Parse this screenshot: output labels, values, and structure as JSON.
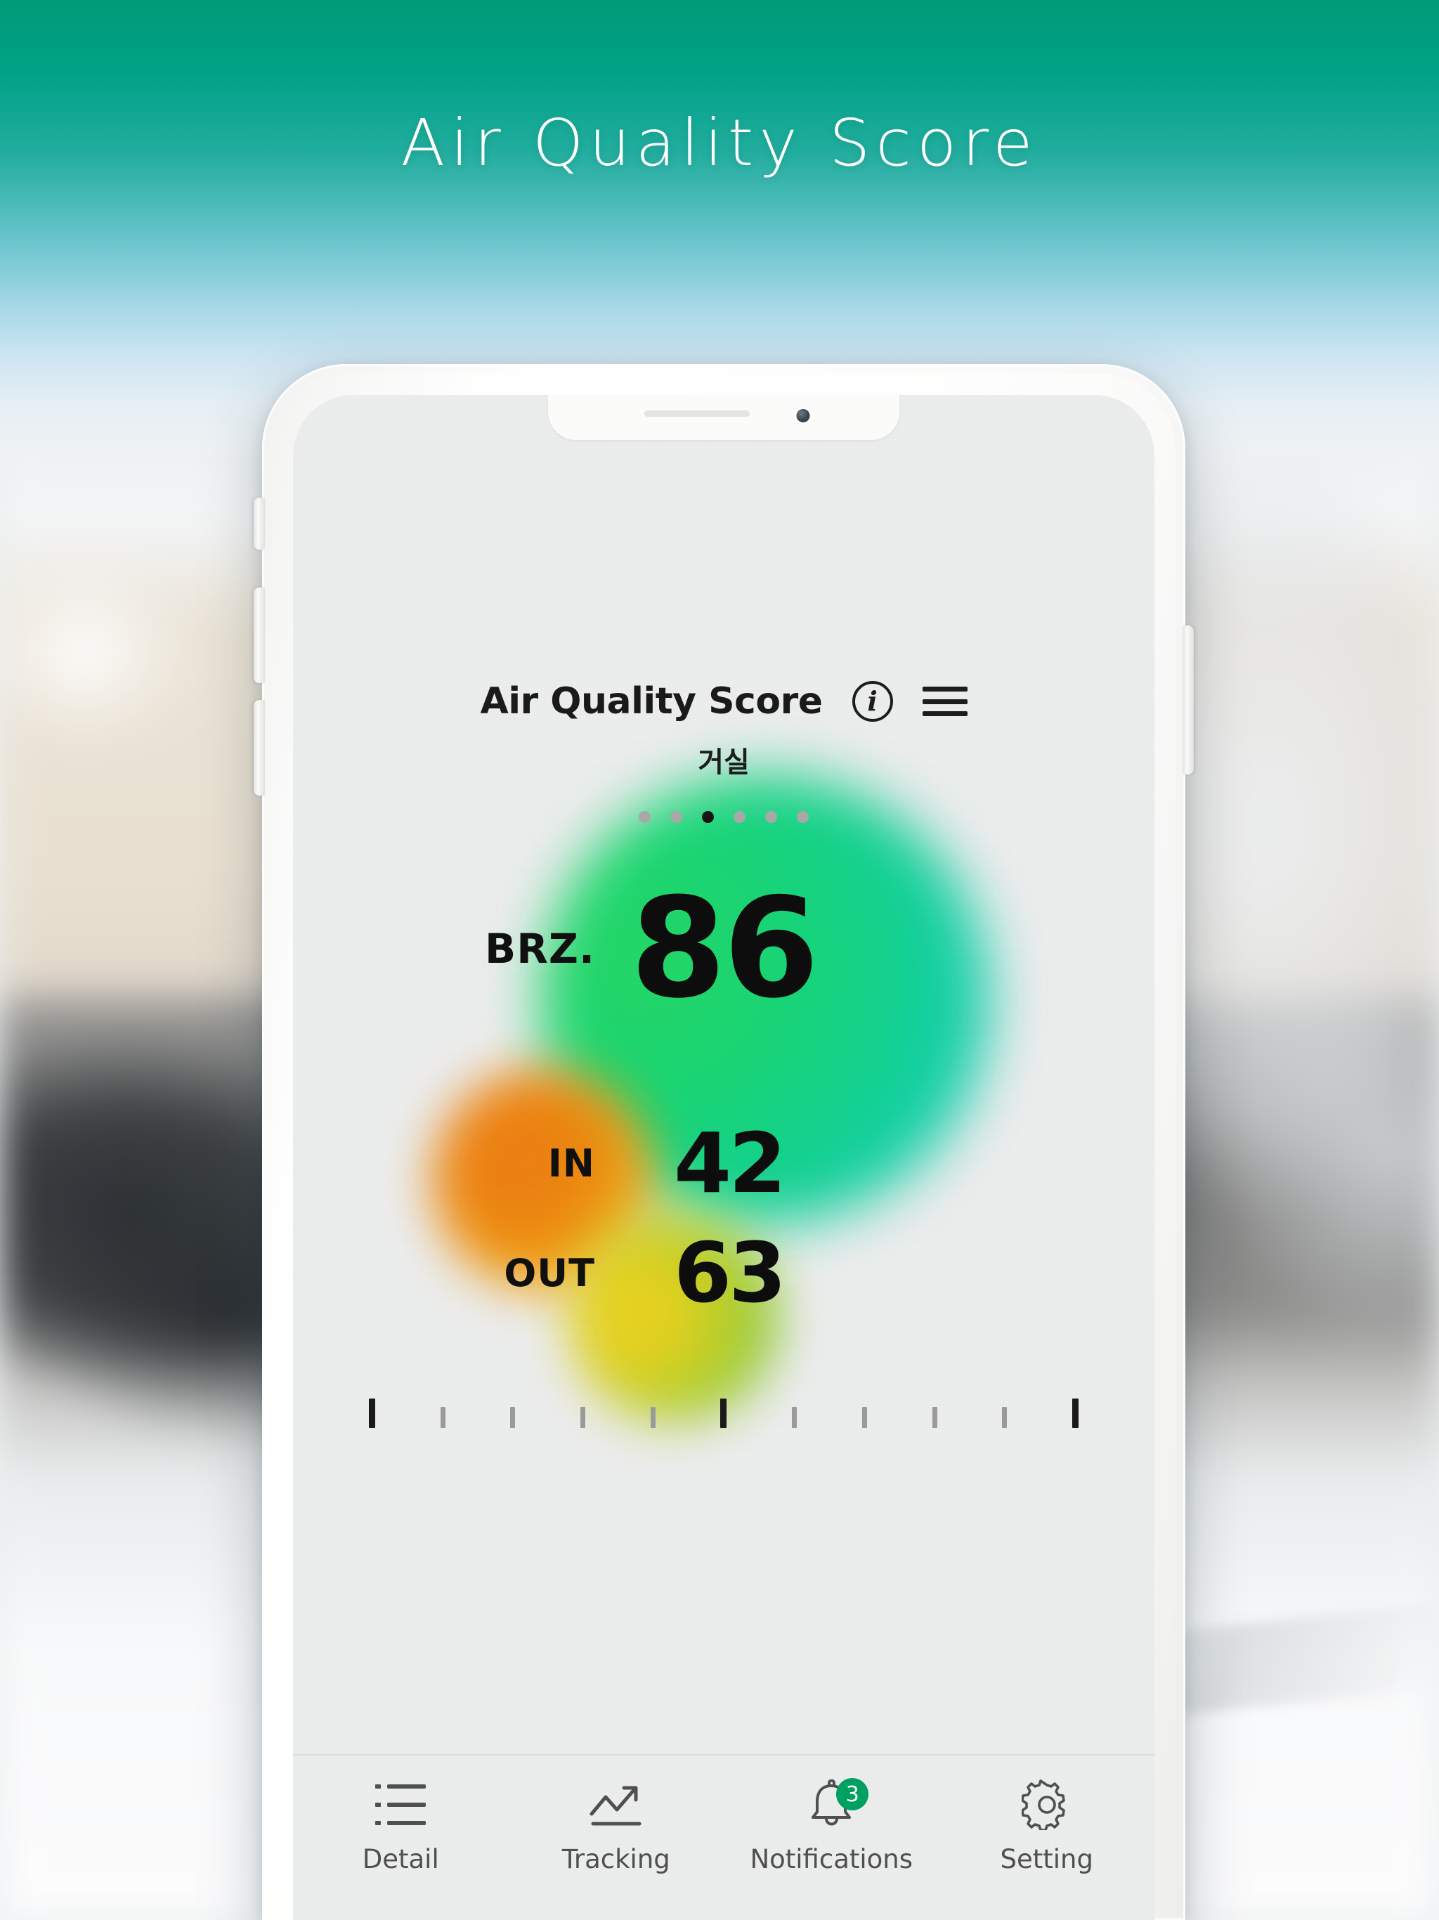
{
  "page": {
    "title": "Air Quality Score"
  },
  "colors": {
    "sky_top": "#009a78",
    "sky_mid": "#63c3c9",
    "sky_bottom": "#eef2f4",
    "brz_blob": "#0bd188",
    "in_blob": "#ef7a10",
    "out_blob": "#a6cf2c",
    "badge": "#00a060",
    "screen_bg": "#eceded",
    "text": "#1a1a1a"
  },
  "app": {
    "header": {
      "title": "Air Quality Score",
      "info_icon": "info-circle-icon",
      "info_glyph": "i",
      "menu_icon": "hamburger-menu-icon"
    },
    "room_name": "거실",
    "pager": {
      "count": 6,
      "active_index": 2
    },
    "metrics": [
      {
        "key": "brz",
        "label": "BRZ.",
        "value": "86"
      },
      {
        "key": "in",
        "label": "IN",
        "value": "42"
      },
      {
        "key": "out",
        "label": "OUT",
        "value": "63"
      }
    ],
    "ruler": {
      "tick_count": 11,
      "major_indices": [
        0,
        5,
        10
      ]
    },
    "tabs": [
      {
        "key": "detail",
        "label": "Detail",
        "icon": "list-icon",
        "badge": null
      },
      {
        "key": "tracking",
        "label": "Tracking",
        "icon": "trend-up-icon",
        "badge": null
      },
      {
        "key": "notifications",
        "label": "Notifications",
        "icon": "bell-icon",
        "badge": "3"
      },
      {
        "key": "setting",
        "label": "Setting",
        "icon": "gear-icon",
        "badge": null
      }
    ]
  }
}
